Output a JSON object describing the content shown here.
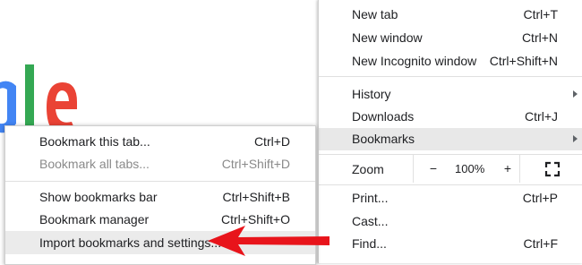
{
  "colors": {
    "highlight": "#e8e8e8",
    "arrow": "#e8141b",
    "disabled": "#8a8a8a"
  },
  "main_menu": {
    "new_tab": {
      "label": "New tab",
      "shortcut": "Ctrl+T"
    },
    "new_window": {
      "label": "New window",
      "shortcut": "Ctrl+N"
    },
    "new_incognito": {
      "label": "New Incognito window",
      "shortcut": "Ctrl+Shift+N"
    },
    "history": {
      "label": "History"
    },
    "downloads": {
      "label": "Downloads",
      "shortcut": "Ctrl+J"
    },
    "bookmarks": {
      "label": "Bookmarks"
    },
    "zoom": {
      "label": "Zoom",
      "minus": "−",
      "value": "100%",
      "plus": "+"
    },
    "print": {
      "label": "Print...",
      "shortcut": "Ctrl+P"
    },
    "cast": {
      "label": "Cast..."
    },
    "find": {
      "label": "Find...",
      "shortcut": "Ctrl+F"
    }
  },
  "bookmarks_menu": {
    "bookmark_tab": {
      "label": "Bookmark this tab...",
      "shortcut": "Ctrl+D"
    },
    "bookmark_all": {
      "label": "Bookmark all tabs...",
      "shortcut": "Ctrl+Shift+D"
    },
    "show_bar": {
      "label": "Show bookmarks bar",
      "shortcut": "Ctrl+Shift+B"
    },
    "manager": {
      "label": "Bookmark manager",
      "shortcut": "Ctrl+Shift+O"
    },
    "import": {
      "label": "Import bookmarks and settings..."
    }
  }
}
